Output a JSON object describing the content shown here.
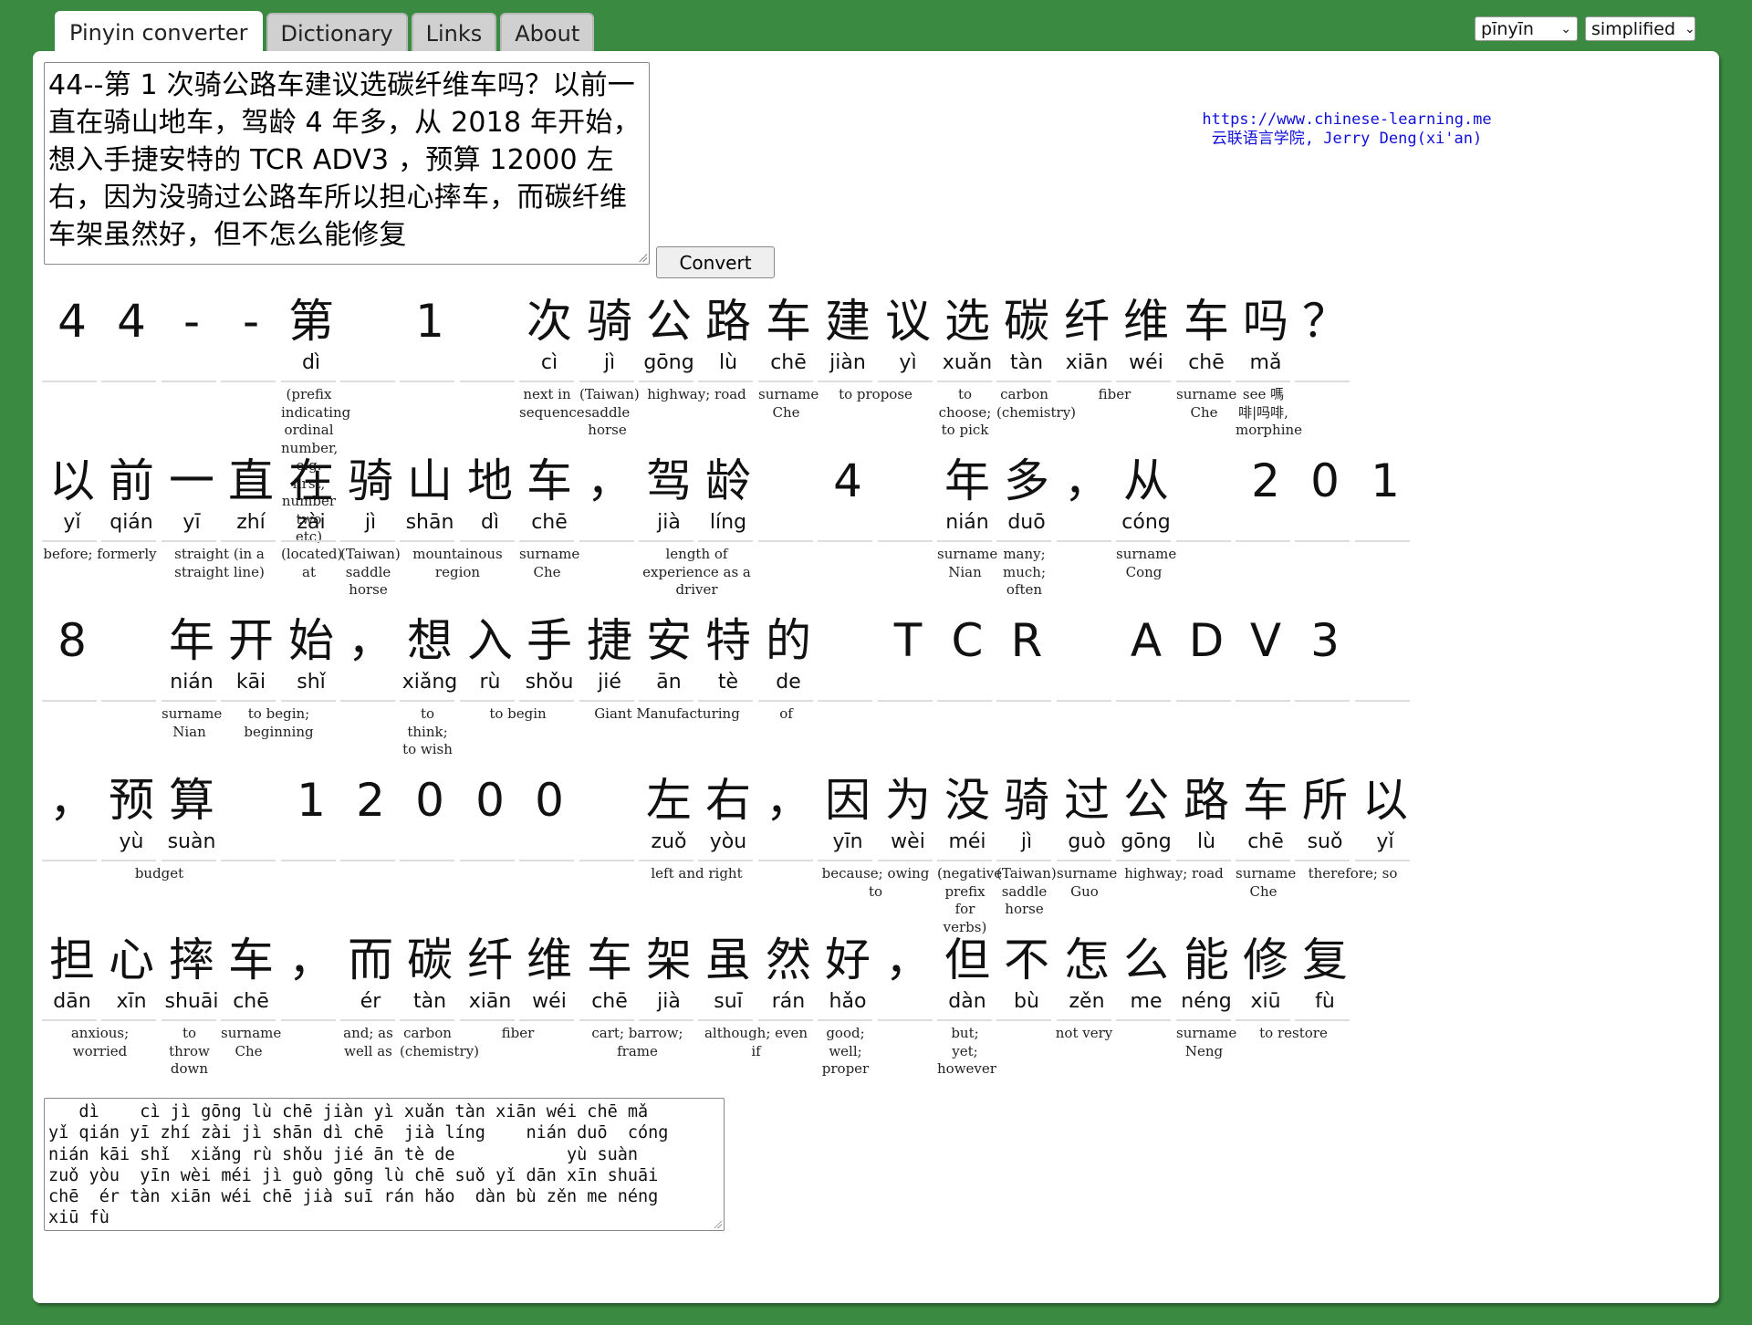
{
  "tabs": [
    "Pinyin converter",
    "Dictionary",
    "Links",
    "About"
  ],
  "selects": {
    "romanization": "pīnyīn",
    "script": "simplified"
  },
  "input_text": "44--第 1 次骑公路车建议选碳纤维车吗？以前一直在骑山地车，驾龄 4 年多，从 2018 年开始，想入手捷安特的 TCR ADV3 ，预算 12000 左右，因为没骑过公路车所以担心摔车，而碳纤维车架虽然好，但不怎么能修复",
  "convert_label": "Convert",
  "credit": [
    "https://www.chinese-learning.me",
    "云联语言学院, Jerry Deng(xi'an)"
  ],
  "rows": [
    {
      "cells": [
        {
          "c": "4",
          "p": ""
        },
        {
          "c": "4",
          "p": ""
        },
        {
          "c": "-",
          "p": ""
        },
        {
          "c": "-",
          "p": ""
        },
        {
          "c": "第",
          "p": "dì"
        },
        {
          "c": "",
          "p": ""
        },
        {
          "c": "1",
          "p": ""
        },
        {
          "c": "",
          "p": ""
        },
        {
          "c": "次",
          "p": "cì"
        },
        {
          "c": "骑",
          "p": "jì"
        },
        {
          "c": "公",
          "p": "gōng"
        },
        {
          "c": "路",
          "p": "lù"
        },
        {
          "c": "车",
          "p": "chē"
        },
        {
          "c": "建",
          "p": "jiàn"
        },
        {
          "c": "议",
          "p": "yì"
        },
        {
          "c": "选",
          "p": "xuǎn"
        },
        {
          "c": "碳",
          "p": "tàn"
        },
        {
          "c": "纤",
          "p": "xiān"
        },
        {
          "c": "维",
          "p": "wéi"
        },
        {
          "c": "车",
          "p": "chē"
        },
        {
          "c": "吗",
          "p": "mǎ"
        },
        {
          "c": "？",
          "p": ""
        }
      ],
      "defs": [
        {
          "start": 4,
          "span": 1,
          "t": "(prefix indicating ordinal number, e.g. first, number two etc)"
        },
        {
          "start": 8,
          "span": 1,
          "t": "next in sequence"
        },
        {
          "start": 9,
          "span": 1,
          "t": "(Taiwan) saddle horse"
        },
        {
          "start": 10,
          "span": 2,
          "t": "highway; road"
        },
        {
          "start": 12,
          "span": 1,
          "t": "surname Che"
        },
        {
          "start": 13,
          "span": 2,
          "t": "to propose"
        },
        {
          "start": 15,
          "span": 1,
          "t": "to choose; to pick"
        },
        {
          "start": 16,
          "span": 1,
          "t": "carbon (chemistry)"
        },
        {
          "start": 17,
          "span": 2,
          "t": "fiber"
        },
        {
          "start": 19,
          "span": 1,
          "t": "surname Che"
        },
        {
          "start": 20,
          "span": 1,
          "t": "see 嗎啡|吗啡, morphine"
        }
      ]
    },
    {
      "cells": [
        {
          "c": "以",
          "p": "yǐ"
        },
        {
          "c": "前",
          "p": "qián"
        },
        {
          "c": "一",
          "p": "yī"
        },
        {
          "c": "直",
          "p": "zhí"
        },
        {
          "c": "在",
          "p": "zài"
        },
        {
          "c": "骑",
          "p": "jì"
        },
        {
          "c": "山",
          "p": "shān"
        },
        {
          "c": "地",
          "p": "dì"
        },
        {
          "c": "车",
          "p": "chē"
        },
        {
          "c": "，",
          "p": ""
        },
        {
          "c": "驾",
          "p": "jià"
        },
        {
          "c": "龄",
          "p": "líng"
        },
        {
          "c": "",
          "p": ""
        },
        {
          "c": "4",
          "p": ""
        },
        {
          "c": "",
          "p": ""
        },
        {
          "c": "年",
          "p": "nián"
        },
        {
          "c": "多",
          "p": "duō"
        },
        {
          "c": "，",
          "p": ""
        },
        {
          "c": "从",
          "p": "cóng"
        },
        {
          "c": "",
          "p": ""
        },
        {
          "c": "2",
          "p": ""
        },
        {
          "c": "0",
          "p": ""
        },
        {
          "c": "1",
          "p": ""
        }
      ],
      "defs": [
        {
          "start": 0,
          "span": 2,
          "t": "before; formerly"
        },
        {
          "start": 2,
          "span": 2,
          "t": "straight (in a straight line)"
        },
        {
          "start": 4,
          "span": 1,
          "t": "(located) at"
        },
        {
          "start": 5,
          "span": 1,
          "t": "(Taiwan) saddle horse"
        },
        {
          "start": 6,
          "span": 2,
          "t": "mountainous region"
        },
        {
          "start": 8,
          "span": 1,
          "t": "surname Che"
        },
        {
          "start": 10,
          "span": 2,
          "t": "length of experience as a driver"
        },
        {
          "start": 15,
          "span": 1,
          "t": "surname Nian"
        },
        {
          "start": 16,
          "span": 1,
          "t": "many; much; often"
        },
        {
          "start": 18,
          "span": 1,
          "t": "surname Cong"
        }
      ]
    },
    {
      "cells": [
        {
          "c": "8",
          "p": ""
        },
        {
          "c": "",
          "p": ""
        },
        {
          "c": "年",
          "p": "nián"
        },
        {
          "c": "开",
          "p": "kāi"
        },
        {
          "c": "始",
          "p": "shǐ"
        },
        {
          "c": "，",
          "p": ""
        },
        {
          "c": "想",
          "p": "xiǎng"
        },
        {
          "c": "入",
          "p": "rù"
        },
        {
          "c": "手",
          "p": "shǒu"
        },
        {
          "c": "捷",
          "p": "jié"
        },
        {
          "c": "安",
          "p": "ān"
        },
        {
          "c": "特",
          "p": "tè"
        },
        {
          "c": "的",
          "p": "de"
        },
        {
          "c": "",
          "p": ""
        },
        {
          "c": "T",
          "p": ""
        },
        {
          "c": "C",
          "p": ""
        },
        {
          "c": "R",
          "p": ""
        },
        {
          "c": "",
          "p": ""
        },
        {
          "c": "A",
          "p": ""
        },
        {
          "c": "D",
          "p": ""
        },
        {
          "c": "V",
          "p": ""
        },
        {
          "c": "3",
          "p": ""
        },
        {
          "c": "",
          "p": ""
        }
      ],
      "defs": [
        {
          "start": 2,
          "span": 1,
          "t": "surname Nian"
        },
        {
          "start": 3,
          "span": 2,
          "t": "to begin; beginning"
        },
        {
          "start": 6,
          "span": 1,
          "t": "to think; to wish"
        },
        {
          "start": 7,
          "span": 2,
          "t": "to begin"
        },
        {
          "start": 9,
          "span": 3,
          "t": "Giant Manufacturing"
        },
        {
          "start": 12,
          "span": 1,
          "t": "of"
        }
      ]
    },
    {
      "cells": [
        {
          "c": "，",
          "p": ""
        },
        {
          "c": "预",
          "p": "yù"
        },
        {
          "c": "算",
          "p": "suàn"
        },
        {
          "c": "",
          "p": ""
        },
        {
          "c": "1",
          "p": ""
        },
        {
          "c": "2",
          "p": ""
        },
        {
          "c": "0",
          "p": ""
        },
        {
          "c": "0",
          "p": ""
        },
        {
          "c": "0",
          "p": ""
        },
        {
          "c": "",
          "p": ""
        },
        {
          "c": "左",
          "p": "zuǒ"
        },
        {
          "c": "右",
          "p": "yòu"
        },
        {
          "c": "，",
          "p": ""
        },
        {
          "c": "因",
          "p": "yīn"
        },
        {
          "c": "为",
          "p": "wèi"
        },
        {
          "c": "没",
          "p": "méi"
        },
        {
          "c": "骑",
          "p": "jì"
        },
        {
          "c": "过",
          "p": "guò"
        },
        {
          "c": "公",
          "p": "gōng"
        },
        {
          "c": "路",
          "p": "lù"
        },
        {
          "c": "车",
          "p": "chē"
        },
        {
          "c": "所",
          "p": "suǒ"
        },
        {
          "c": "以",
          "p": "yǐ"
        }
      ],
      "defs": [
        {
          "start": 1,
          "span": 2,
          "t": "budget"
        },
        {
          "start": 10,
          "span": 2,
          "t": "left and right"
        },
        {
          "start": 13,
          "span": 2,
          "t": "because; owing to"
        },
        {
          "start": 15,
          "span": 1,
          "t": "(negative prefix for verbs)"
        },
        {
          "start": 16,
          "span": 1,
          "t": "(Taiwan) saddle horse"
        },
        {
          "start": 17,
          "span": 1,
          "t": "surname Guo"
        },
        {
          "start": 18,
          "span": 2,
          "t": "highway; road"
        },
        {
          "start": 20,
          "span": 1,
          "t": "surname Che"
        },
        {
          "start": 21,
          "span": 2,
          "t": "therefore; so"
        }
      ]
    },
    {
      "cells": [
        {
          "c": "担",
          "p": "dān"
        },
        {
          "c": "心",
          "p": "xīn"
        },
        {
          "c": "摔",
          "p": "shuāi"
        },
        {
          "c": "车",
          "p": "chē"
        },
        {
          "c": "，",
          "p": ""
        },
        {
          "c": "而",
          "p": "ér"
        },
        {
          "c": "碳",
          "p": "tàn"
        },
        {
          "c": "纤",
          "p": "xiān"
        },
        {
          "c": "维",
          "p": "wéi"
        },
        {
          "c": "车",
          "p": "chē"
        },
        {
          "c": "架",
          "p": "jià"
        },
        {
          "c": "虽",
          "p": "suī"
        },
        {
          "c": "然",
          "p": "rán"
        },
        {
          "c": "好",
          "p": "hǎo"
        },
        {
          "c": "，",
          "p": ""
        },
        {
          "c": "但",
          "p": "dàn"
        },
        {
          "c": "不",
          "p": "bù"
        },
        {
          "c": "怎",
          "p": "zěn"
        },
        {
          "c": "么",
          "p": "me"
        },
        {
          "c": "能",
          "p": "néng"
        },
        {
          "c": "修",
          "p": "xiū"
        },
        {
          "c": "复",
          "p": "fù"
        }
      ],
      "defs": [
        {
          "start": 0,
          "span": 2,
          "t": "anxious; worried"
        },
        {
          "start": 2,
          "span": 1,
          "t": "to throw down"
        },
        {
          "start": 3,
          "span": 1,
          "t": "surname Che"
        },
        {
          "start": 5,
          "span": 1,
          "t": "and; as well as"
        },
        {
          "start": 6,
          "span": 1,
          "t": "carbon (chemistry)"
        },
        {
          "start": 7,
          "span": 2,
          "t": "fiber"
        },
        {
          "start": 9,
          "span": 2,
          "t": "cart; barrow; frame"
        },
        {
          "start": 11,
          "span": 2,
          "t": "although; even if"
        },
        {
          "start": 13,
          "span": 1,
          "t": "good; well; proper"
        },
        {
          "start": 15,
          "span": 1,
          "t": "but; yet; however"
        },
        {
          "start": 16,
          "span": 3,
          "t": "not very"
        },
        {
          "start": 19,
          "span": 1,
          "t": "surname Neng"
        },
        {
          "start": 20,
          "span": 2,
          "t": "to restore"
        }
      ]
    }
  ],
  "output_lines": [
    "   dì    cì jì gōng lù chē jiàn yì xuǎn tàn xiān wéi chē mǎ",
    "yǐ qián yī zhí zài jì shān dì chē  jià líng    nián duō  cóng",
    "nián kāi shǐ  xiǎng rù shǒu jié ān tè de           yù suàn",
    "zuǒ yòu  yīn wèi méi jì guò gōng lù chē suǒ yǐ dān xīn shuāi",
    "chē  ér tàn xiān wéi chē jià suī rán hǎo  dàn bù zěn me néng",
    "xiū fù"
  ]
}
